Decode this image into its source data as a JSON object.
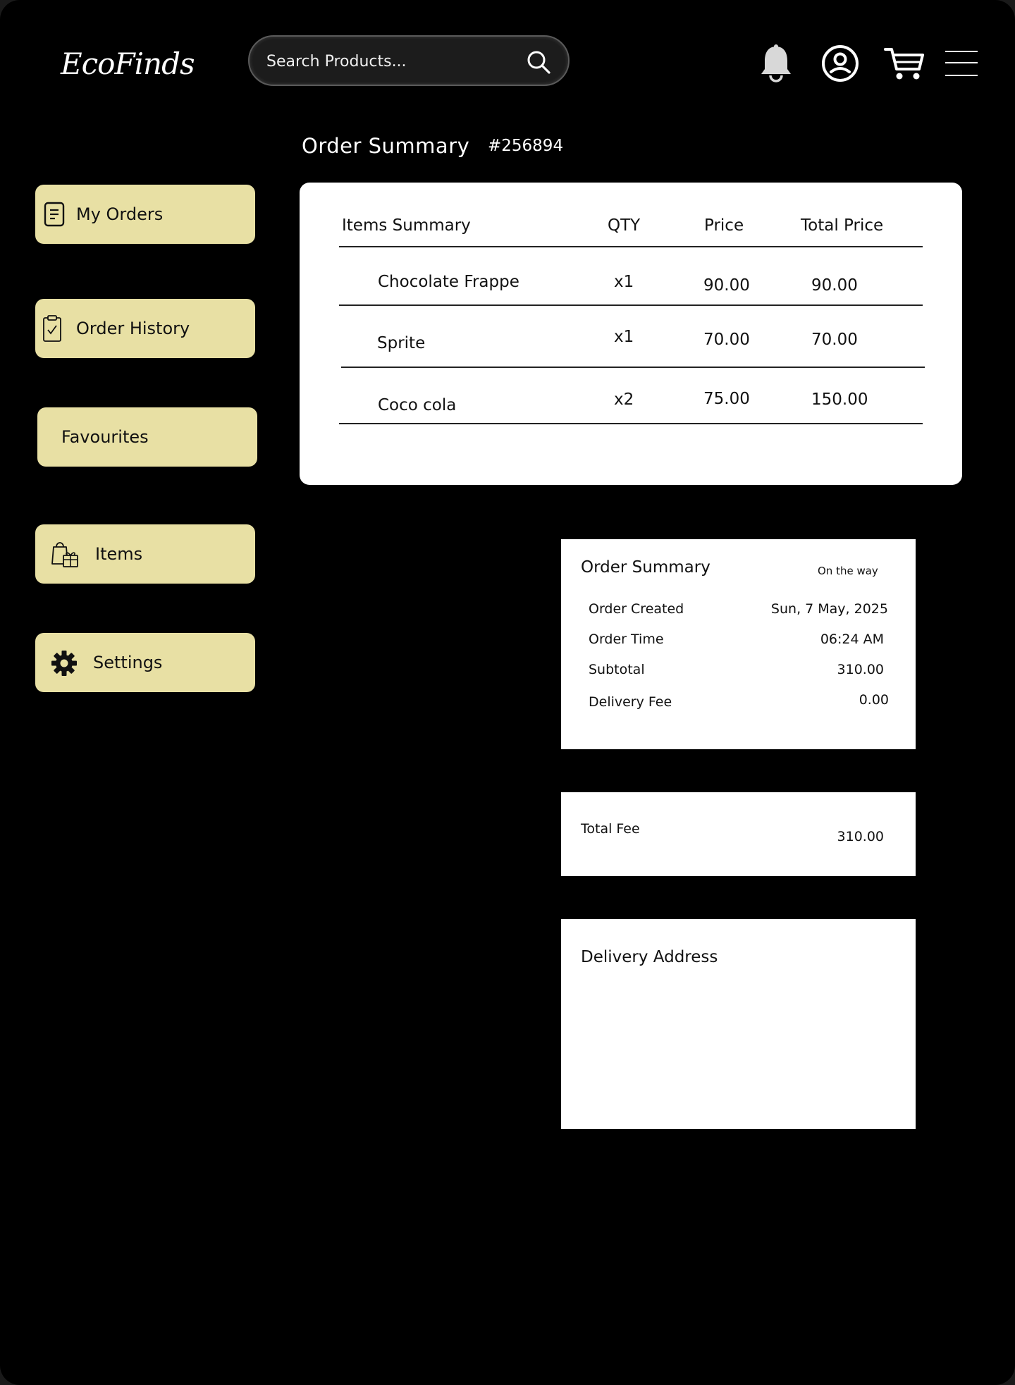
{
  "header": {
    "logo": "EcoFinds",
    "search_placeholder": "Search Products..."
  },
  "page": {
    "title": "Order Summary",
    "order_id": "#256894"
  },
  "sidebar": {
    "items": [
      {
        "label": "My Orders",
        "icon": "receipt-icon"
      },
      {
        "label": "Order History",
        "icon": "clipboard-check-icon"
      },
      {
        "label": "Favourites",
        "icon": ""
      },
      {
        "label": "Items",
        "icon": "shopping-bags-icon"
      },
      {
        "label": "Settings",
        "icon": "gear-icon"
      }
    ]
  },
  "items_table": {
    "headers": [
      "Items Summary",
      "QTY",
      "Price",
      "Total Price"
    ],
    "rows": [
      {
        "name": "Chocolate Frappe",
        "qty": "x1",
        "price": "90.00",
        "total": "90.00"
      },
      {
        "name": "Sprite",
        "qty": "x1",
        "price": "70.00",
        "total": "70.00"
      },
      {
        "name": "Coco cola",
        "qty": "x2",
        "price": "75.00",
        "total": "150.00"
      }
    ]
  },
  "order_summary": {
    "title": "Order Summary",
    "status": "On the way",
    "rows": [
      {
        "label": "Order Created",
        "value": "Sun, 7 May, 2025"
      },
      {
        "label": "Order Time",
        "value": "06:24 AM"
      },
      {
        "label": "Subtotal",
        "value": "310.00"
      },
      {
        "label": "Delivery Fee",
        "value": "0.00"
      }
    ]
  },
  "total": {
    "label": "Total Fee",
    "value": "310.00"
  },
  "delivery": {
    "title": "Delivery Address"
  }
}
